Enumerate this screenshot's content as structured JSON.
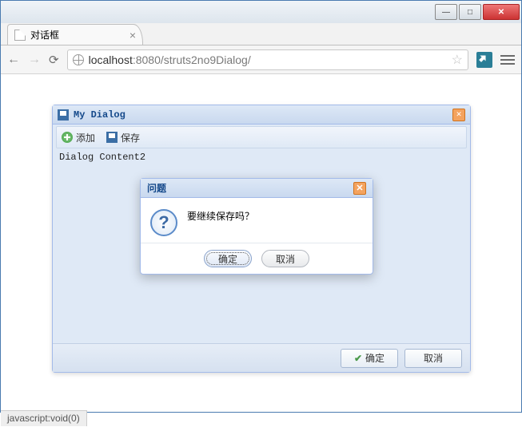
{
  "browser": {
    "tab_title": "对话框",
    "url_host": "localhost",
    "url_port_path": ":8080/struts2no9Dialog/",
    "status_text": "javascript:void(0)"
  },
  "panel": {
    "title": "My Dialog",
    "toolbar": {
      "add": "添加",
      "save": "保存"
    },
    "content": "Dialog Content2",
    "footer": {
      "ok": "确定",
      "cancel": "取消"
    }
  },
  "confirm": {
    "title": "问题",
    "message": "要继续保存吗？",
    "ok": "确定",
    "cancel": "取消"
  }
}
